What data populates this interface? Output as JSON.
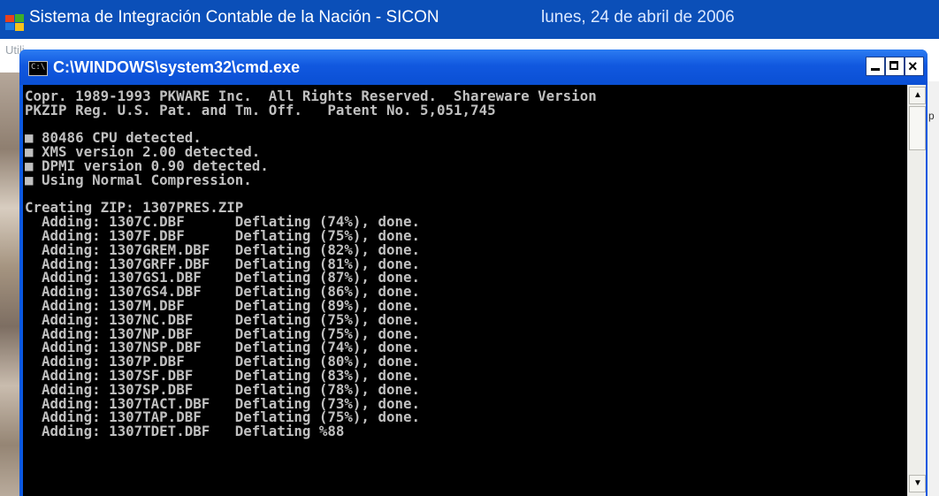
{
  "app": {
    "title": "Sistema de Integración Contable de la Nación - SICON",
    "date": "lunes, 24 de abril de 2006",
    "menu_fragment": "Utili",
    "right_fragment": "p"
  },
  "cmd": {
    "title": "C:\\WINDOWS\\system32\\cmd.exe",
    "icon_text": "C:\\",
    "controls": {
      "minimize": "_",
      "maximize": "□",
      "close": "×"
    },
    "lines": [
      "Copr. 1989-1993 PKWARE Inc.  All Rights Reserved.  Shareware Version",
      "PKZIP Reg. U.S. Pat. and Tm. Off.   Patent No. 5,051,745",
      "",
      "■ 80486 CPU detected.",
      "■ XMS version 2.00 detected.",
      "■ DPMI version 0.90 detected.",
      "■ Using Normal Compression.",
      "",
      "Creating ZIP: 1307PRES.ZIP",
      "  Adding: 1307C.DBF      Deflating (74%), done.",
      "  Adding: 1307F.DBF      Deflating (75%), done.",
      "  Adding: 1307GREM.DBF   Deflating (82%), done.",
      "  Adding: 1307GRFF.DBF   Deflating (81%), done.",
      "  Adding: 1307GS1.DBF    Deflating (87%), done.",
      "  Adding: 1307GS4.DBF    Deflating (86%), done.",
      "  Adding: 1307M.DBF      Deflating (89%), done.",
      "  Adding: 1307NC.DBF     Deflating (75%), done.",
      "  Adding: 1307NP.DBF     Deflating (75%), done.",
      "  Adding: 1307NSP.DBF    Deflating (74%), done.",
      "  Adding: 1307P.DBF      Deflating (80%), done.",
      "  Adding: 1307SF.DBF     Deflating (83%), done.",
      "  Adding: 1307SP.DBF     Deflating (78%), done.",
      "  Adding: 1307TACT.DBF   Deflating (73%), done.",
      "  Adding: 1307TAP.DBF    Deflating (75%), done.",
      "  Adding: 1307TDET.DBF   Deflating %88"
    ]
  },
  "colors": {
    "titlebar_blue": "#0a4fd4",
    "console_bg": "#000000",
    "console_fg": "#c0c0c0",
    "app_titlebar": "#0b4fb8"
  },
  "icons": {
    "app": "colorful-windows-flag-icon",
    "cmd": "cmd-prompt-icon",
    "scroll_up": "arrow-up-icon",
    "scroll_down": "arrow-down-icon"
  }
}
